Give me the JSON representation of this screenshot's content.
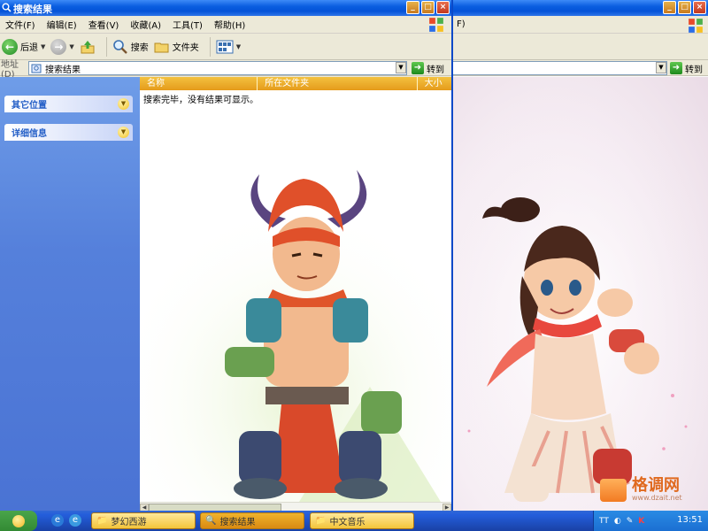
{
  "main_window": {
    "title": "搜索结果",
    "menu": [
      "文件(F)",
      "编辑(E)",
      "查看(V)",
      "收藏(A)",
      "工具(T)",
      "帮助(H)"
    ],
    "toolbar": {
      "back_label": "后退",
      "search_label": "搜索",
      "folders_label": "文件夹"
    },
    "address": {
      "label": "地址(D)",
      "value": "搜索结果",
      "go_label": "转到"
    },
    "sidebar_panels": [
      "其它位置",
      "详细信息"
    ],
    "columns": [
      "名称",
      "所在文件夹",
      "大小"
    ],
    "status_text": "搜索完毕，没有结果可显示。"
  },
  "bg_window": {
    "menu_fragment": "F)",
    "go_label": "转到"
  },
  "taskbar": {
    "tasks": [
      {
        "label": "梦幻西游",
        "active": false
      },
      {
        "label": "搜索结果",
        "active": true
      },
      {
        "label": "中文音乐",
        "active": false
      }
    ],
    "tray_text": "TT",
    "clock": "13:51"
  },
  "watermark": {
    "text": "格调网",
    "url": "www.dzait.net"
  },
  "colors": {
    "title_blue": "#0a5ee0",
    "sidebar_blue": "#5580db",
    "header_orange": "#e59b1b",
    "start_green": "#338a34",
    "taskbar_blue": "#245edb"
  },
  "icons": [
    "folder-icon",
    "back-arrow-icon",
    "forward-arrow-icon",
    "up-folder-icon",
    "search-icon",
    "folders-icon",
    "views-icon",
    "go-arrow-icon",
    "windows-logo-icon",
    "ie-icon",
    "chevron-up-icon"
  ]
}
